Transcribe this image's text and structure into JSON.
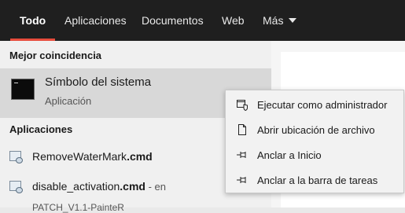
{
  "tabs": [
    {
      "label": "Todo",
      "active": true
    },
    {
      "label": "Aplicaciones"
    },
    {
      "label": "Documentos"
    },
    {
      "label": "Web"
    },
    {
      "label": "Más"
    }
  ],
  "best_match": {
    "header": "Mejor coincidencia",
    "title": "Símbolo del sistema",
    "subtitle": "Aplicación",
    "icon": "command-prompt-icon"
  },
  "apps": {
    "header": "Aplicaciones",
    "items": [
      {
        "name": "RemoveWaterMark",
        "ext": ".cmd",
        "suffix": "",
        "location": "",
        "icon": "cmd-file-icon"
      },
      {
        "name": "disable_activation",
        "ext": ".cmd",
        "suffix": " - en",
        "location": "PATCH_V1.1-PainteR",
        "icon": "cmd-file-icon"
      }
    ]
  },
  "context_menu": {
    "items": [
      {
        "label": "Ejecutar como administrador",
        "icon": "run-as-admin-icon"
      },
      {
        "label": "Abrir ubicación de archivo",
        "icon": "open-file-location-icon"
      },
      {
        "label": "Anclar a Inicio",
        "icon": "pin-icon"
      },
      {
        "label": "Anclar a la barra de tareas",
        "icon": "pin-icon"
      }
    ]
  },
  "colors": {
    "topbar_bg": "#1f1f1f",
    "active_tab_underline": "#e74c3c",
    "left_panel_bg": "#f0f0f0",
    "selected_row_bg": "#d8d8d8",
    "menu_bg": "#f2f2f2"
  }
}
